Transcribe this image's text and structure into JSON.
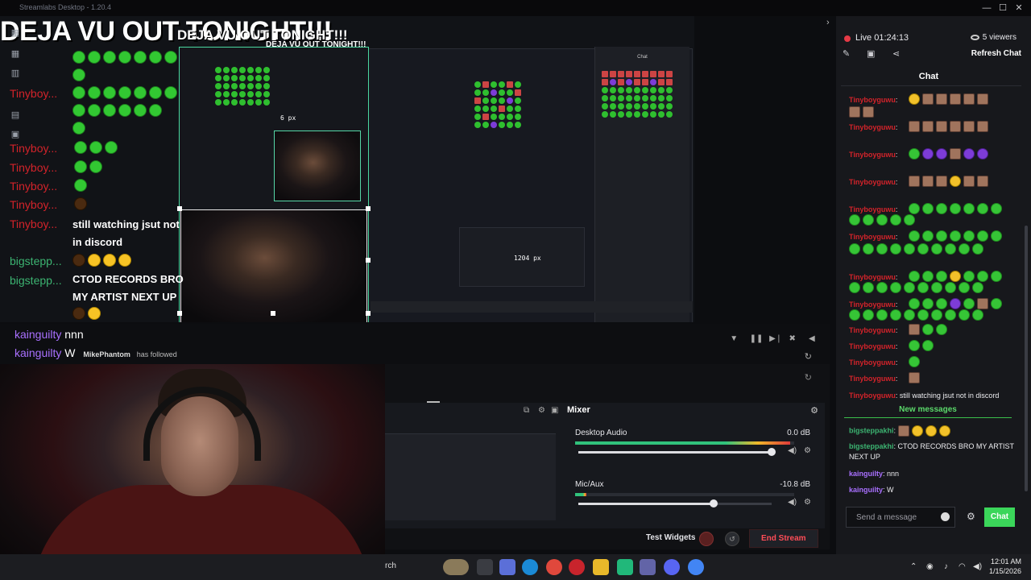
{
  "window": {
    "app_title": "Streamlabs Desktop - 1.20.4",
    "controls": [
      "—",
      "☐",
      "✕"
    ]
  },
  "preview": {
    "overlay_text": "DEJA VU OUT TONIGHT!!!",
    "px_label_a": "6 px",
    "px_label_b": "1204 px",
    "echo_chat": [
      {
        "user": "Tinyboy...",
        "text": ""
      },
      {
        "user": "Tinyboy...",
        "text": ""
      },
      {
        "user": "Tinyboy...",
        "text": ""
      },
      {
        "user": "Tinyboy...",
        "text": ""
      },
      {
        "user": "Tinyboy...",
        "text": ""
      },
      {
        "user": "Tinyboy...",
        "text": "still watching jsut not"
      },
      {
        "user": "",
        "text": "in discord"
      },
      {
        "user": "bigstepp...",
        "text": ""
      },
      {
        "user": "bigstepp...",
        "text": "CTOD RECORDS BRO"
      },
      {
        "user": "",
        "text": "MY ARTIST NEXT UP"
      }
    ]
  },
  "feed": {
    "row1_user": "kainguilty",
    "row1_text": "nnn",
    "row2_user": "kainguilty",
    "row2_text": "W",
    "follow_user": "MikePhantom",
    "follow_text": "has followed"
  },
  "mixer": {
    "title": "Mixer",
    "channels": [
      {
        "name": "Desktop Audio",
        "db": "0.0 dB",
        "meter": 0.98,
        "volume": 1.0
      },
      {
        "name": "Mic/Aux",
        "db": "-10.8 dB",
        "meter": 0.05,
        "volume": 0.7
      }
    ],
    "test_widgets": "Test Widgets",
    "end_stream": "End Stream"
  },
  "side": {
    "live_time": "Live 01:24:13",
    "viewers": "5 viewers",
    "refresh_chat": "Refresh Chat",
    "chat_title": "Chat",
    "new_messages": "New messages",
    "send_placeholder": "Send a message",
    "chat_button": "Chat",
    "messages": [
      {
        "user": "Tinyboyguwu",
        "color": "#d3232a",
        "text": ""
      },
      {
        "user": "Tinyboyguwu",
        "color": "#d3232a",
        "text": ""
      },
      {
        "user": "Tinyboyguwu",
        "color": "#d3232a",
        "text": ""
      },
      {
        "user": "Tinyboyguwu",
        "color": "#d3232a",
        "text": ""
      },
      {
        "user": "Tinyboyguwu",
        "color": "#d3232a",
        "text": ""
      },
      {
        "user": "Tinyboyguwu",
        "color": "#d3232a",
        "text": ""
      },
      {
        "user": "Tinyboyguwu",
        "color": "#d3232a",
        "text": ""
      },
      {
        "user": "Tinyboyguwu",
        "color": "#d3232a",
        "text": ""
      },
      {
        "user": "Tinyboyguwu",
        "color": "#d3232a",
        "text": ""
      },
      {
        "user": "Tinyboyguwu",
        "color": "#d3232a",
        "text": ""
      },
      {
        "user": "Tinyboyguwu",
        "color": "#d3232a",
        "text": ""
      },
      {
        "user": "Tinyboyguwu",
        "color": "#d3232a",
        "text": ""
      },
      {
        "user": "Tinyboyguwu",
        "color": "#d3232a",
        "text": "still watching jsut not in discord"
      }
    ],
    "new_messages_list": [
      {
        "user": "bigsteppakhi",
        "color": "#3cb371",
        "text": ""
      },
      {
        "user": "bigsteppakhi",
        "color": "#3cb371",
        "text": "CTOD RECORDS BRO MY ARTIST NEXT UP"
      },
      {
        "user": "kainguilty",
        "color": "#a970ff",
        "text": "nnn"
      },
      {
        "user": "kainguilty",
        "color": "#a970ff",
        "text": "W"
      }
    ]
  },
  "taskbar": {
    "search_text": "rch",
    "time": "12:01 AM",
    "date": "1/15/2026"
  },
  "colors": {
    "accent_green": "#3bd65a",
    "live_red": "#e63a46",
    "end_stream_red": "#ff4d57"
  }
}
